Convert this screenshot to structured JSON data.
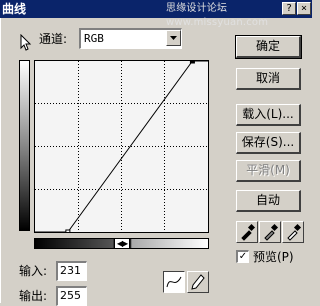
{
  "window": {
    "title": "曲线",
    "watermark": "思缘设计论坛 www.missyuan.com",
    "controls": [
      "?",
      "×"
    ]
  },
  "channel": {
    "label": "通道:",
    "value": "RGB"
  },
  "input": {
    "label": "输入:",
    "value": "231"
  },
  "output": {
    "label": "输出:",
    "value": "255"
  },
  "buttons": {
    "ok": "确定",
    "cancel": "取消",
    "load": "载入(L)...",
    "save": "保存(S)...",
    "smooth": "平滑(M)",
    "auto": "自动"
  },
  "preview": {
    "label": "预览(P)",
    "checked": true
  },
  "curve": {
    "points": [
      [
        0,
        0
      ],
      [
        0.19,
        0
      ],
      [
        0.91,
        1
      ],
      [
        1,
        1
      ]
    ],
    "selected_point": [
      0.91,
      1
    ]
  },
  "colors": {
    "titlebar": "#0a246a",
    "dialog_bg": "#d4d0c8",
    "curve_bg": "#f4f4f4"
  },
  "icons": {
    "pointer": "hand-pointer-icon",
    "curve_tool": "curve-tool-icon",
    "pencil_tool": "pencil-tool-icon",
    "black_dropper": "eyedropper-black-icon",
    "gray_dropper": "eyedropper-gray-icon",
    "white_dropper": "eyedropper-white-icon",
    "gradient_toggle": "gradient-toggle-icon"
  }
}
